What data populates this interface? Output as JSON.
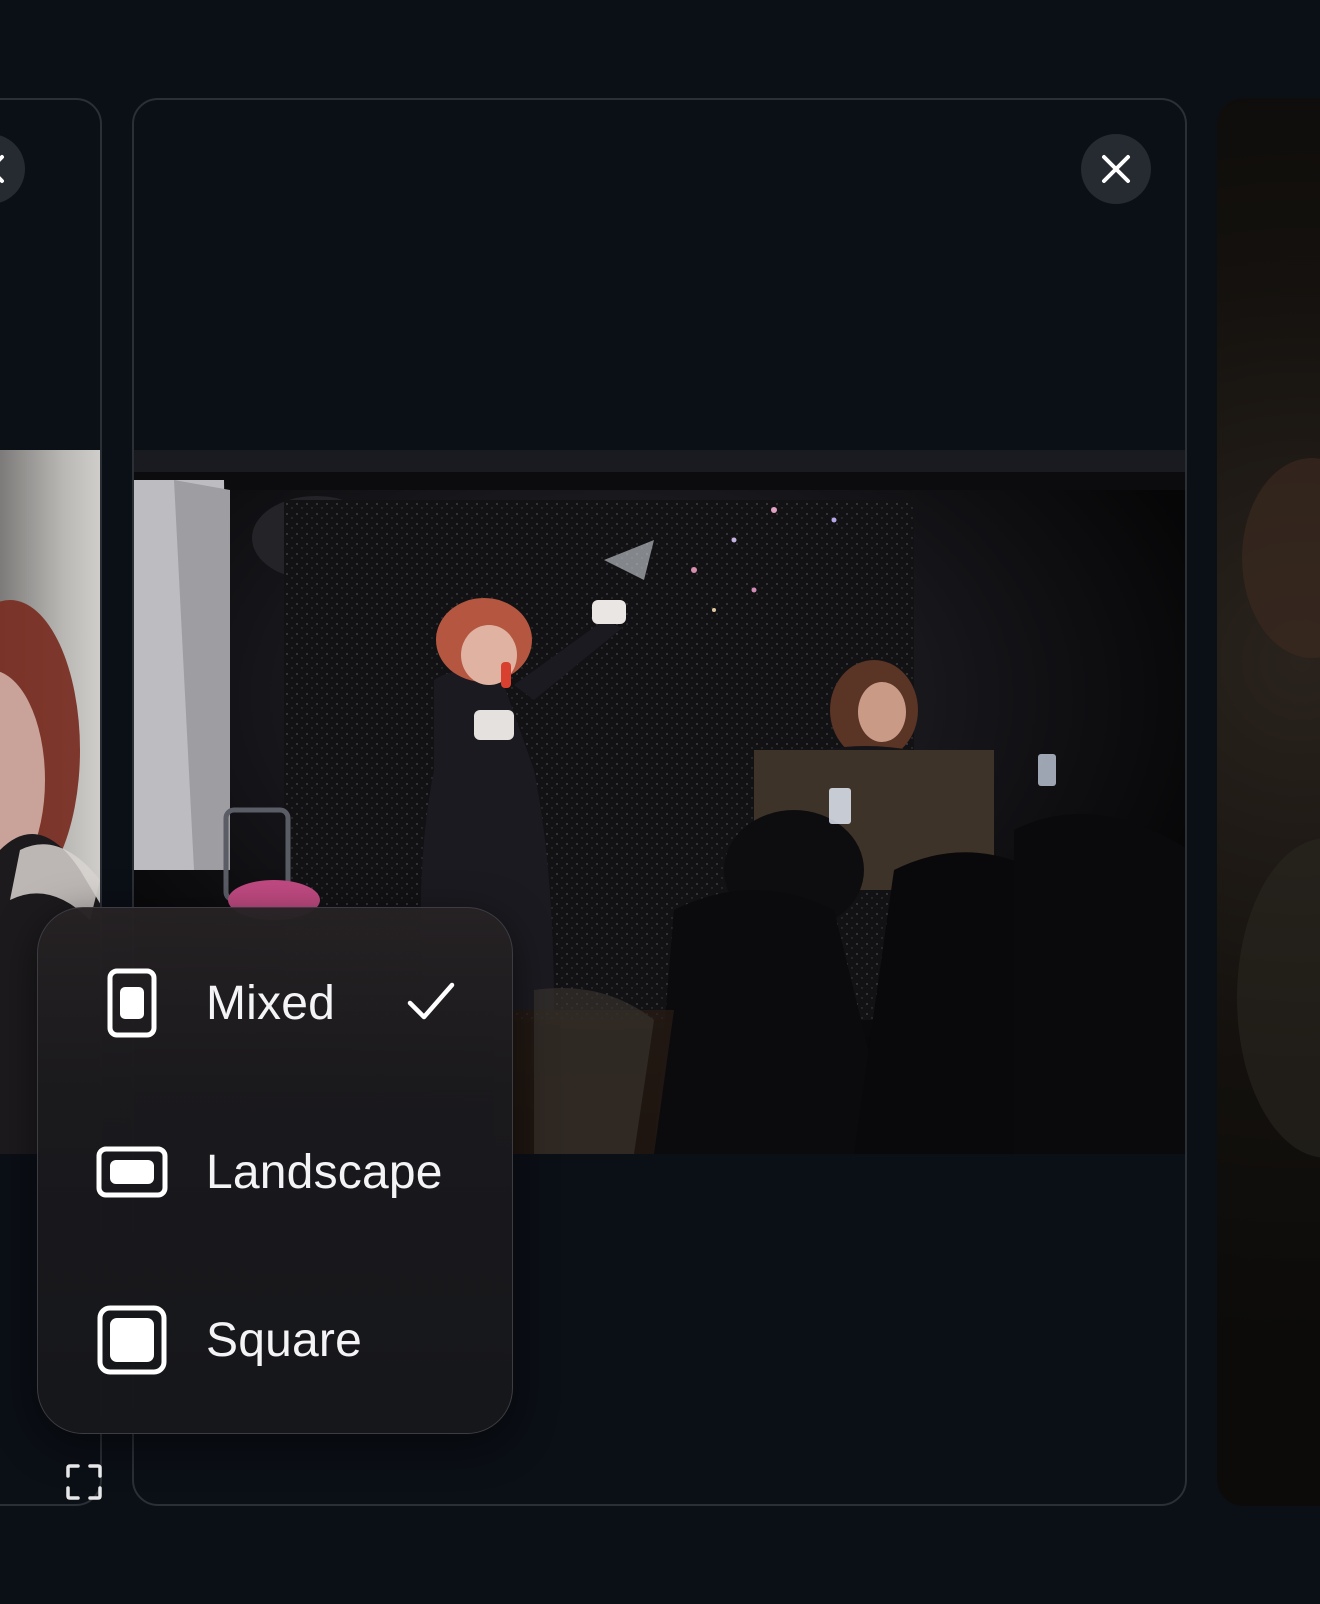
{
  "photo_size_menu": {
    "items": [
      {
        "label": "Mixed",
        "icon": "portrait-frame-icon",
        "selected": true
      },
      {
        "label": "Landscape",
        "icon": "landscape-frame-icon",
        "selected": false
      },
      {
        "label": "Square",
        "icon": "square-frame-icon",
        "selected": false
      }
    ]
  },
  "icons": {
    "close": "close-icon",
    "checkmark": "checkmark-icon",
    "expand": "expand-icon"
  },
  "colors": {
    "background": "#0b0f16",
    "card_border": "#2b2f36",
    "menu_text": "#f4f4f6"
  }
}
